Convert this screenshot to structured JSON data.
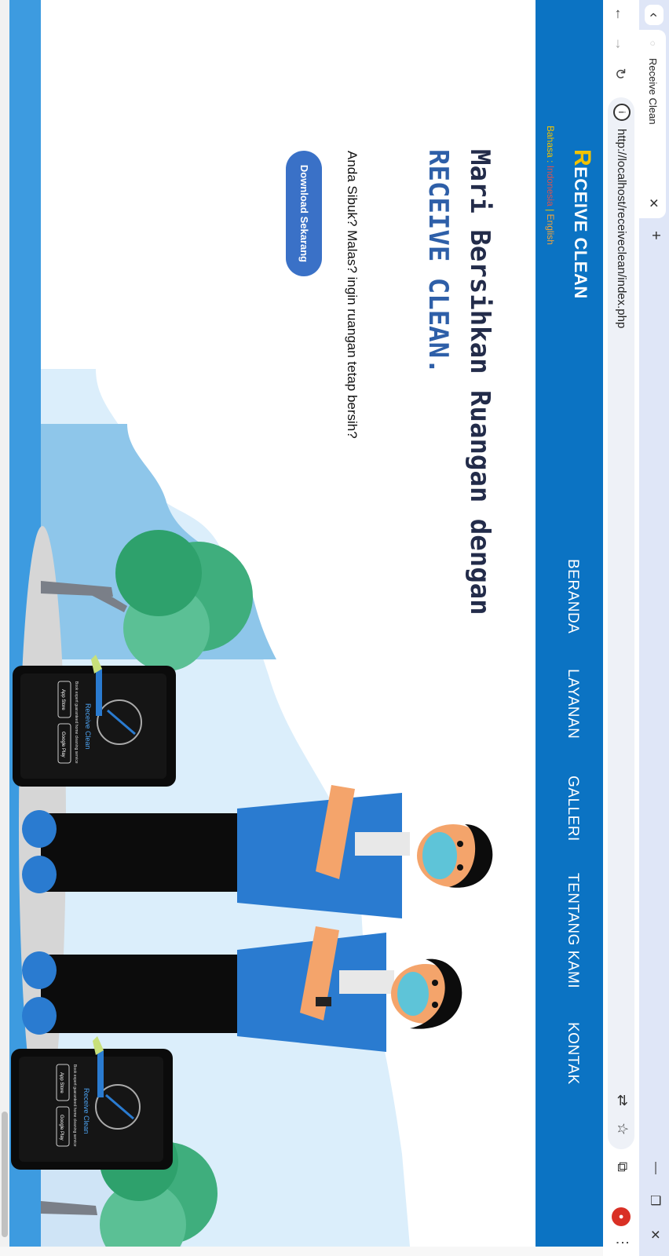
{
  "browser": {
    "tab_title": "Receive Clean",
    "tab_close": "✕",
    "new_tab": "+",
    "back_tabs": "‹",
    "url": "http://localhost/receiveclean/index.php",
    "nav": {
      "back": "←",
      "forward": "→",
      "reload": "↻"
    },
    "info": "i",
    "win": {
      "minimize": "—",
      "restore": "❐",
      "close": "✕"
    },
    "menu": "⋮",
    "icons": {
      "translate": "⇄",
      "star": "☆",
      "extension": "⧉",
      "avatar": "●"
    }
  },
  "header": {
    "brand_initial": "R",
    "brand_rest": "ECEIVE CLEAN",
    "lang_label": "Bahasa : ",
    "lang_id": "Indonesia",
    "lang_sep": " | ",
    "lang_en": "English",
    "nav": [
      "BERANDA",
      "LAYANAN",
      "GALLERI",
      "TENTANG KAMI",
      "KONTAK"
    ]
  },
  "hero": {
    "headline": "Mari Bersihkan Ruangan dengan",
    "headline_brand": "RECEIVE CLEAN.",
    "subtext": "Anda Sibuk? Malas? ingin ruangan tetap bersih?",
    "cta": "Download Sekarang"
  },
  "phone": {
    "logo_text": "Receive Clean",
    "tagline": "Book expert guaranteed home cleaning service",
    "app_store": "App Store",
    "google_play": "Google Play"
  },
  "colors": {
    "header_bg": "#0b73c3",
    "brand_yellow": "#f2c200",
    "headline_dark": "#232c4a",
    "headline_blue": "#2e5fa8",
    "cta_bg": "#3a71c7",
    "uniform_blue": "#2a7bd0",
    "sky": "#cfe6f7"
  }
}
